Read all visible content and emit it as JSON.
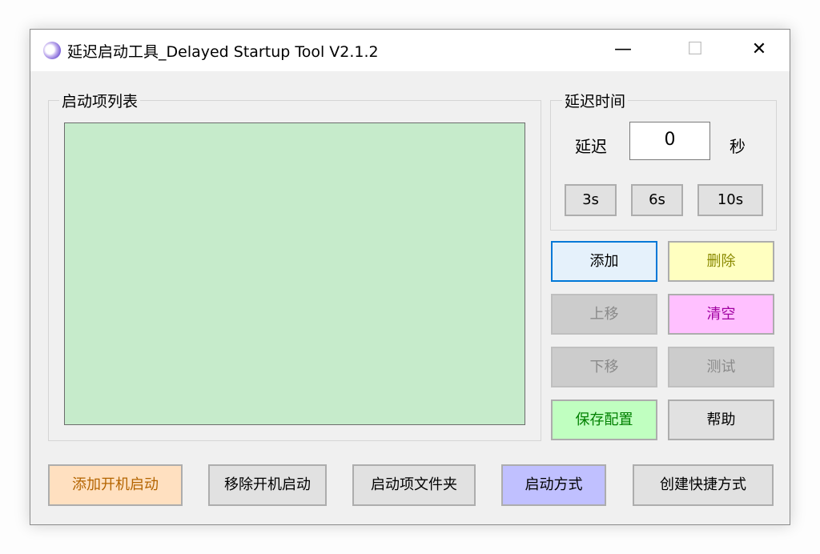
{
  "window": {
    "title": "延迟启动工具_Delayed Startup Tool V2.1.2",
    "minimize": "—",
    "maximize": "☐",
    "close": "✕"
  },
  "startup_list": {
    "label": "启动项列表"
  },
  "delay": {
    "group_label": "延迟时间",
    "prefix_label": "延迟",
    "value": "0",
    "unit_label": "秒",
    "presets": [
      "3s",
      "6s",
      "10s"
    ]
  },
  "actions": {
    "add": "添加",
    "delete": "删除",
    "move_up": "上移",
    "clear": "清空",
    "move_down": "下移",
    "test": "测试",
    "save_config": "保存配置",
    "help": "帮助"
  },
  "bottom": {
    "add_boot": "添加开机启动",
    "remove_boot": "移除开机启动",
    "startup_folder": "启动项文件夹",
    "startup_mode": "启动方式",
    "create_shortcut": "创建快捷方式"
  },
  "colors": {
    "list_bg": "#c6ebcb",
    "delete_bg": "#ffffc0",
    "delete_text": "#8a8a00",
    "clear_bg": "#ffc0ff",
    "clear_text": "#a000a0",
    "save_bg": "#c0ffc0",
    "save_text": "#008000",
    "add_boot_bg": "#ffe0c0",
    "add_boot_text": "#b46400",
    "startup_mode_bg": "#c0c0ff",
    "focus_border": "#0078d7",
    "disabled_text": "#8a8a8a"
  }
}
